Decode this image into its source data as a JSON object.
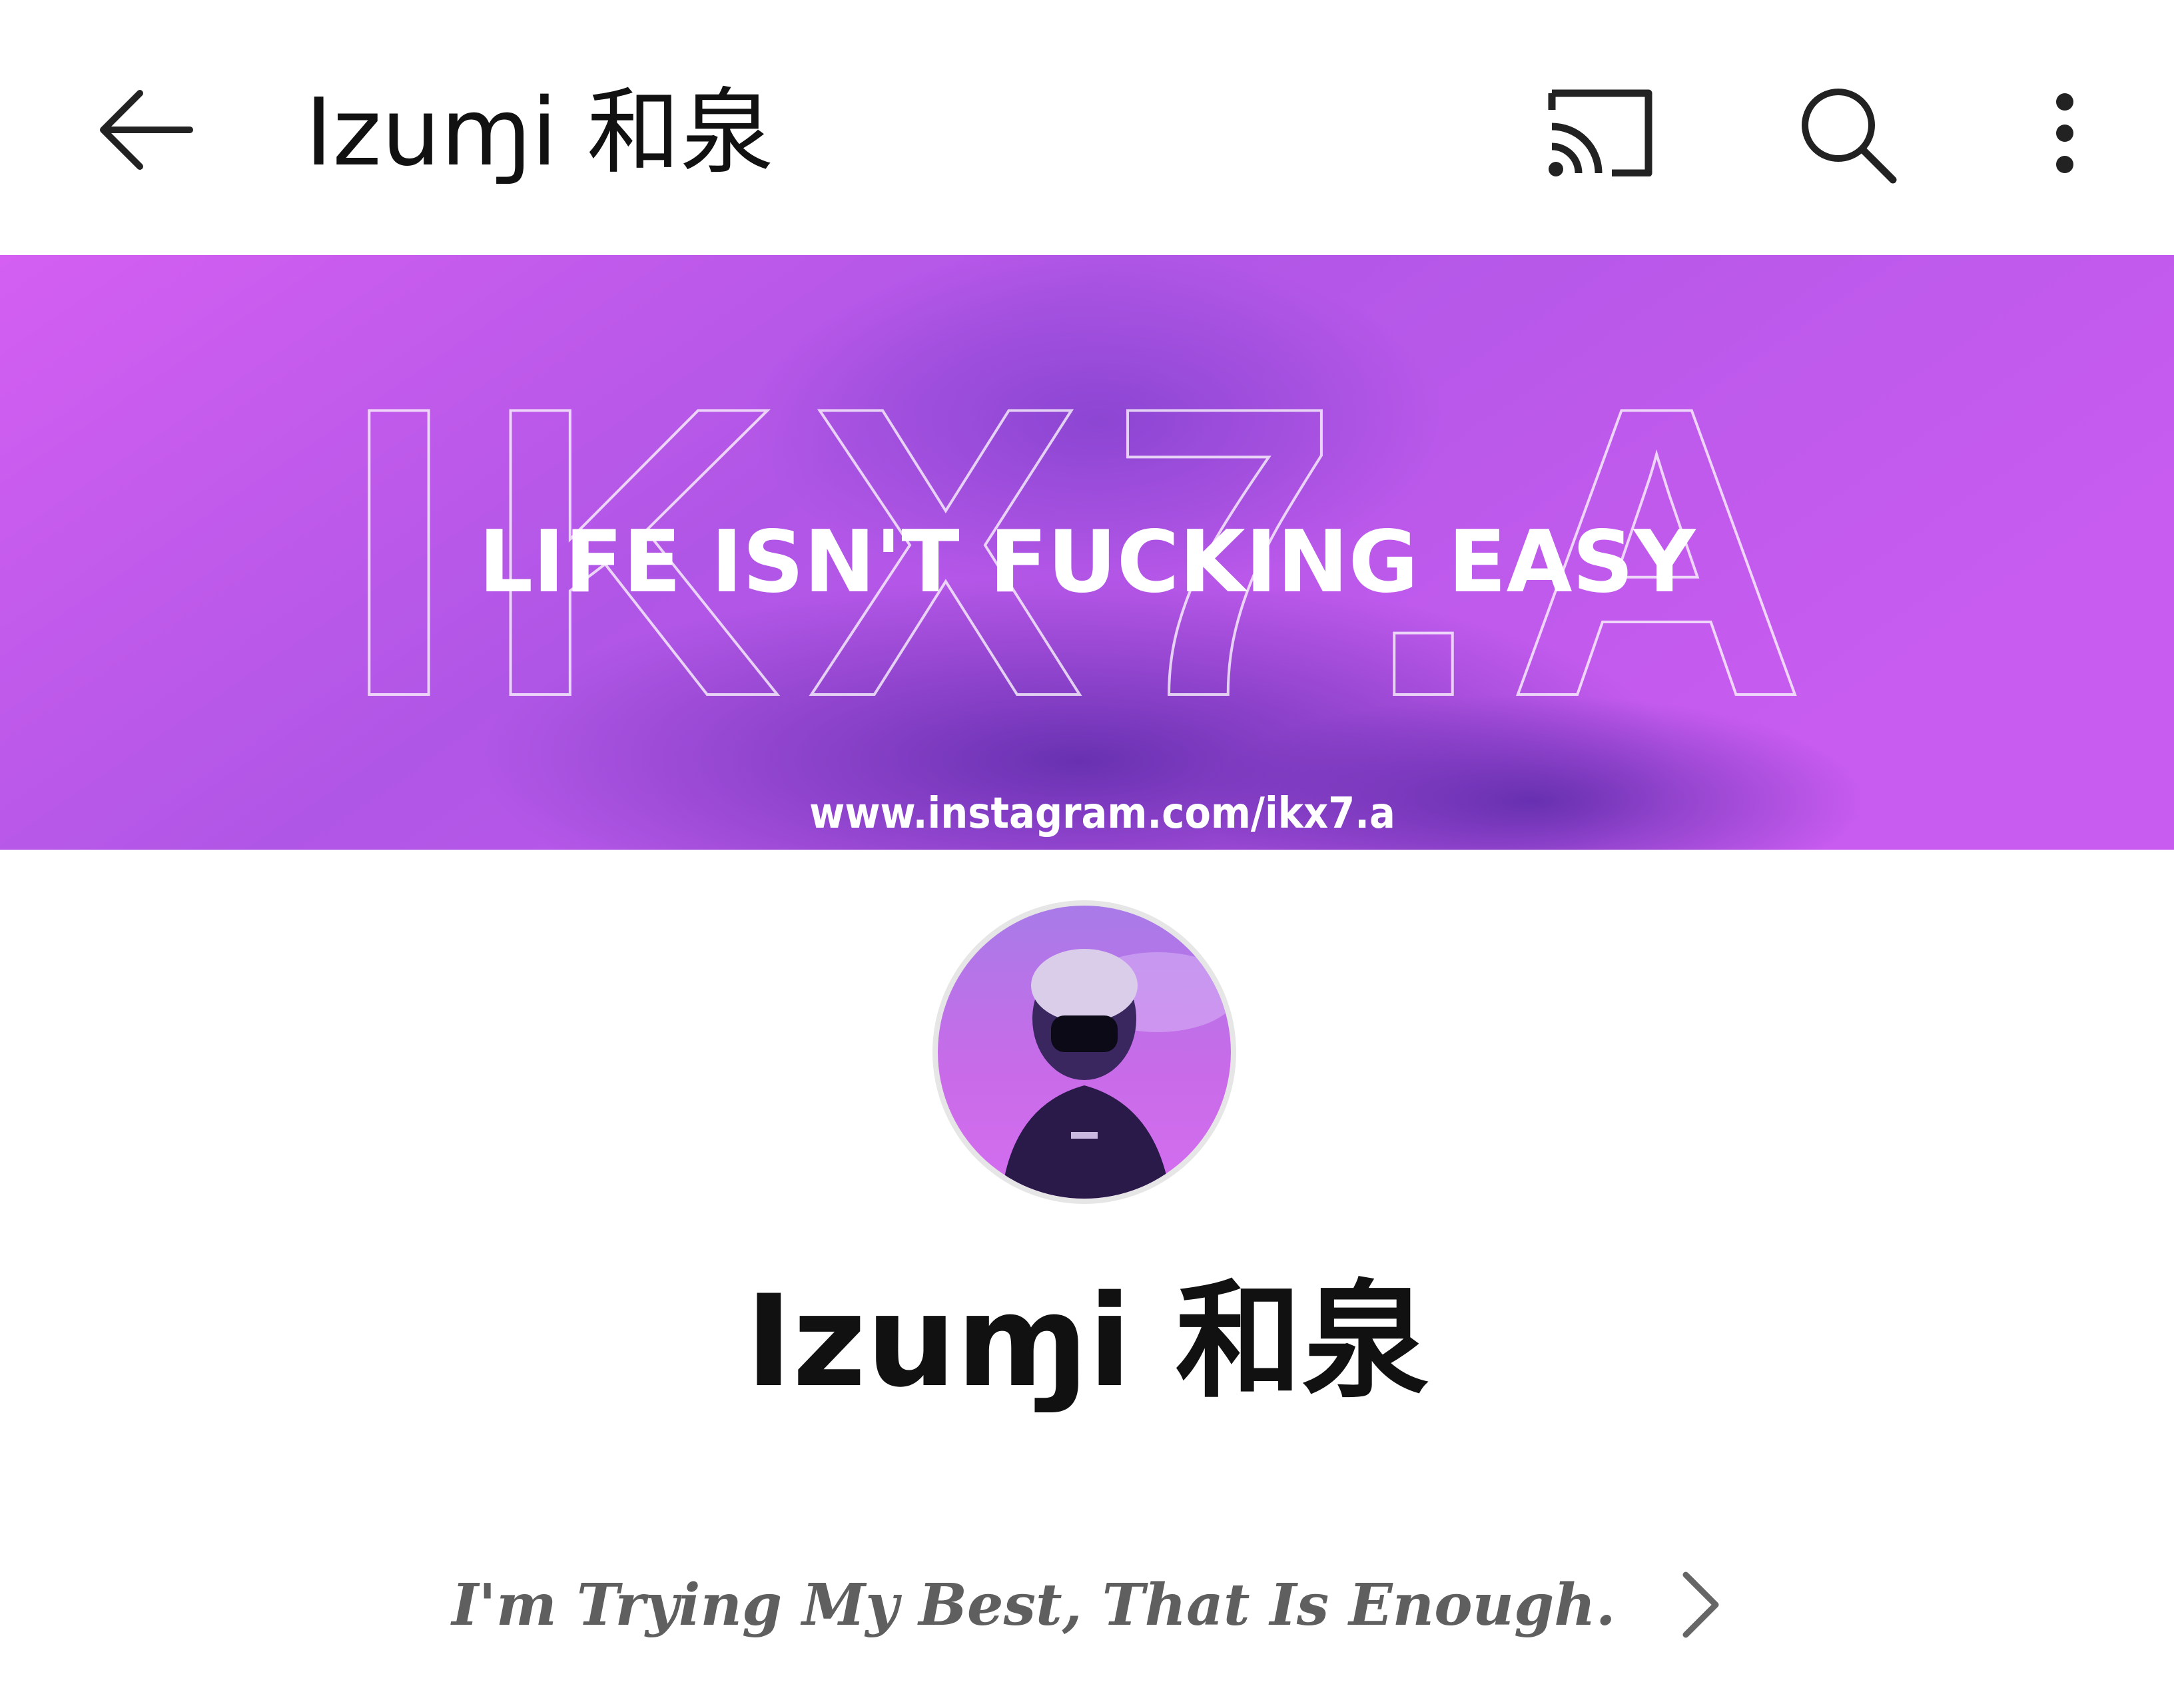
{
  "topbar": {
    "back_icon": "arrow-left-icon",
    "title": "Izuɱi 和泉",
    "cast_icon": "cast-icon",
    "search_icon": "search-icon",
    "more_icon": "more-vertical-icon"
  },
  "banner": {
    "outline_text": "IKX7.A",
    "headline": "LIFE ISN'T FUCKING EASY",
    "url": "www.instagram.com/ikx7.a",
    "accent_color": "#c45cf0"
  },
  "channel": {
    "avatar_icon": "avatar-image",
    "name": "Izuɱi 和泉",
    "tagline": "I'm Trying My Best, That Is Enough.",
    "chevron_icon": "chevron-right-icon"
  }
}
